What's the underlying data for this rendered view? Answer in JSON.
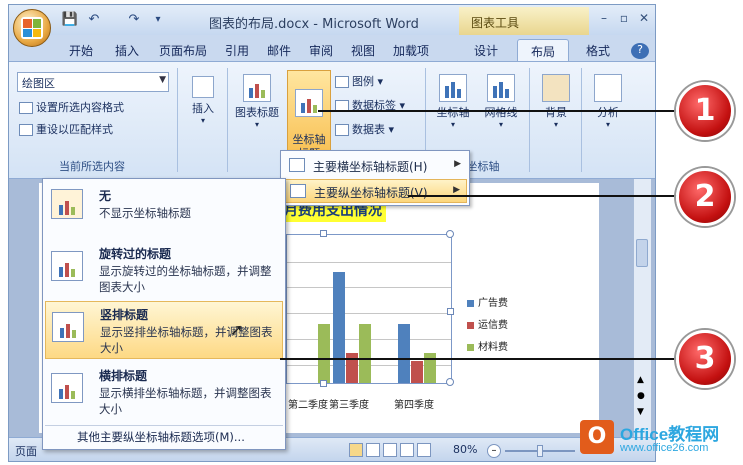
{
  "window": {
    "title": "图表的布局.docx - Microsoft Word",
    "context_tab": "图表工具"
  },
  "tabs": [
    "开始",
    "插入",
    "页面布局",
    "引用",
    "邮件",
    "审阅",
    "视图",
    "加载项",
    "设计",
    "布局",
    "格式"
  ],
  "active_tab": "布局",
  "ribbon": {
    "current_selection": {
      "selected_element": "绘图区",
      "format_selection": "设置所选内容格式",
      "reset_style": "重设以匹配样式",
      "group_label": "当前所选内容"
    },
    "insert": {
      "label": "插入"
    },
    "labels": {
      "chart_title": "图表标题",
      "axis_titles": "坐标轴\n标题",
      "legend": "图例",
      "data_labels": "数据标签",
      "data_table": "数据表"
    },
    "axes": {
      "axis": "坐标轴",
      "gridlines": "网格线",
      "group_label": "坐标轴"
    },
    "background": {
      "label": "背景"
    },
    "analysis": {
      "label": "分析"
    }
  },
  "axis_title_menu": {
    "items": [
      "主要横坐标轴标题(H)",
      "主要纵坐标轴标题(V)"
    ],
    "highlighted_index": 1
  },
  "vertical_axis_menu": {
    "items": [
      {
        "title": "无",
        "desc": "不显示坐标轴标题"
      },
      {
        "title": "旋转过的标题",
        "desc": "显示旋转过的坐标轴标题，并调整图表大小"
      },
      {
        "title": "竖排标题",
        "desc": "显示竖排坐标轴标题，并调整图表大小"
      },
      {
        "title": "横排标题",
        "desc": "显示横排坐标轴标题，并调整图表大小"
      }
    ],
    "highlighted_index": 2,
    "more_options": "其他主要纵坐标轴标题选项(M)..."
  },
  "status": {
    "page_label": "页面",
    "zoom": "80%"
  },
  "callouts": [
    "1",
    "2",
    "3"
  ],
  "chart_data": {
    "type": "bar",
    "title": "月费用支出情况",
    "categories": [
      "第二季度",
      "第三季度",
      "第四季度"
    ],
    "series": [
      {
        "name": "广告费",
        "values": [
          0,
          150,
          80
        ]
      },
      {
        "name": "运信费",
        "values": [
          0,
          40,
          30
        ]
      },
      {
        "name": "材料费",
        "values": [
          80,
          80,
          40
        ]
      }
    ],
    "colors": [
      "#4f81bd",
      "#c0504d",
      "#9bbb59"
    ],
    "ylim": [
      0,
      200
    ],
    "legend": "right",
    "grid": true
  },
  "watermark": {
    "logo": "O",
    "name": "Office教程网",
    "url": "www.office26.com"
  }
}
